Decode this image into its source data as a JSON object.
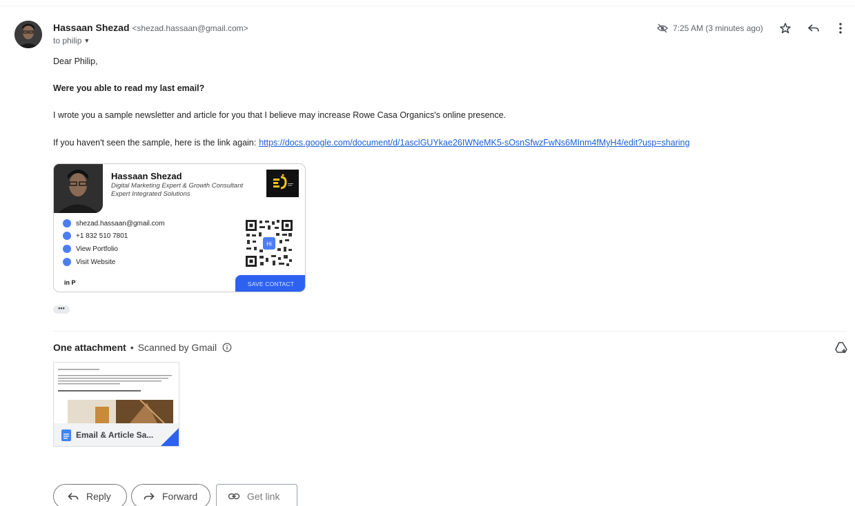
{
  "message": {
    "sender_name": "Hassaan Shezad",
    "sender_email": "<shezad.hassaan@gmail.com>",
    "to_label": "to philip",
    "time": "7:25 AM (3 minutes ago)",
    "icons": [
      "eye-off-icon",
      "star-icon",
      "reply-icon",
      "more-vert-icon"
    ]
  },
  "body": {
    "greeting": "Dear Philip,",
    "question": "Were you able to read my last email?",
    "line1": "I wrote you a sample newsletter and article for you that I believe may increase  Rowe Casa Organics's online presence.",
    "line2_prefix": "If you haven't seen the sample, here is the link again:",
    "link": "https://docs.google.com/document/d/1asclGUYkae26IWNeMK5-sOsnSfwzFwNs6MInm4fMyH4/edit?usp=sharing"
  },
  "signature": {
    "name": "Hassaan Shezad",
    "title": "Digital Marketing Expert & Growth Consultant",
    "company": "Expert Integrated Solutions",
    "email": "shezad.hassaan@gmail.com",
    "phone": "+1 832 510 7801",
    "portfolio": "View Portfolio",
    "website": "Visit Website",
    "social": "in  P",
    "save_contact": "SAVE CONTACT",
    "qr_badge": "Hi",
    "accent": "#2d62f0"
  },
  "trimmed": "•••",
  "attachments": {
    "title": "One attachment",
    "separator": "•",
    "scanned": "Scanned by Gmail",
    "file_name": "Email & Article Sa..."
  },
  "actions": {
    "reply": "Reply",
    "forward": "Forward",
    "get_link": "Get link"
  }
}
